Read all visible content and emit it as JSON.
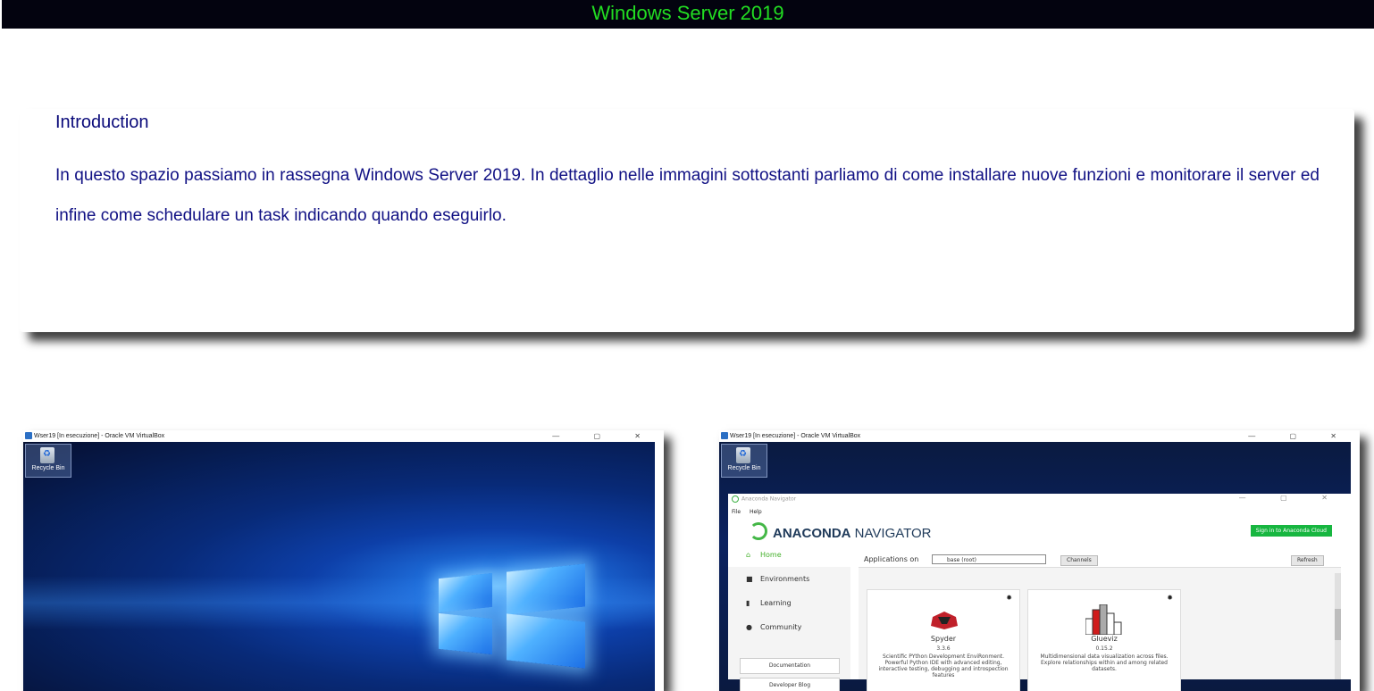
{
  "header": {
    "title": "Windows Server 2019"
  },
  "intro": {
    "heading": "Introduction",
    "body": "In questo spazio passiamo in rassegna Windows Server 2019. In dettaglio nelle immagini sottostanti parliamo di come installare nuove funzioni e monitorare il server ed infine come schedulare un task indicando quando eseguirlo."
  },
  "screenshot_left": {
    "window_title": "Wser19 [In esecuzione] - Oracle VM VirtualBox",
    "window_controls": "— ▢ ✕",
    "desktop_icon_label": "Recycle Bin"
  },
  "screenshot_right": {
    "window_title": "Wser19 [In esecuzione] - Oracle VM VirtualBox",
    "window_controls": "— ▢ ✕",
    "desktop_icon_label": "Recycle Bin",
    "app_title": "Anaconda Navigator",
    "app_controls": "— ▢ ✕",
    "menu": [
      "File",
      "Help"
    ],
    "brand_bold": "ANACONDA",
    "brand_rest": "NAVIGATOR",
    "sign_in": "Sign in to Anaconda Cloud",
    "sidebar": [
      "Home",
      "Environments",
      "Learning",
      "Community"
    ],
    "sidebar_buttons": [
      "Documentation",
      "Developer Blog"
    ],
    "applications_on": "Applications on",
    "env_select": "base (root)",
    "channels": "Channels",
    "refresh": "Refresh",
    "tiles": [
      {
        "name": "Spyder",
        "version": "3.3.6",
        "desc": "Scientific PYthon Development EnviRonment. Powerful Python IDE with advanced editing, interactive testing, debugging and introspection features"
      },
      {
        "name": "Glueviz",
        "version": "0.15.2",
        "desc": "Multidimensional data visualization across files. Explore relationships within and among related datasets."
      }
    ]
  }
}
